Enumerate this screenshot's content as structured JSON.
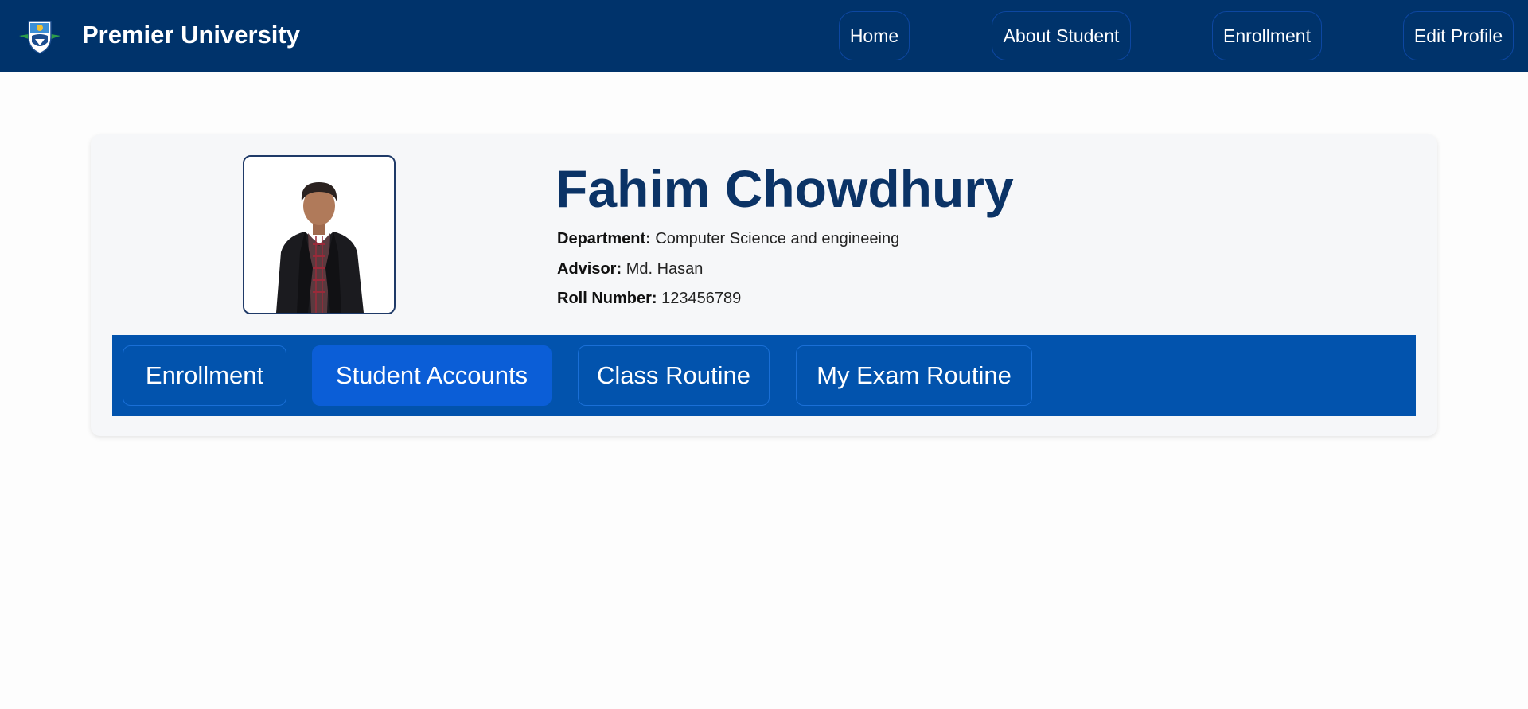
{
  "navbar": {
    "brand_name": "Premier University",
    "logo_icon": "university-crest-icon",
    "items": [
      {
        "label": "Home"
      },
      {
        "label": "About Student"
      },
      {
        "label": "Enrollment"
      },
      {
        "label": "Edit Profile"
      }
    ]
  },
  "profile": {
    "photo_icon": "student-photo",
    "name": "Fahim Chowdhury",
    "department_label": "Department:",
    "department_value": "Computer Science and engineeing",
    "advisor_label": "Advisor:",
    "advisor_value": "Md. Hasan",
    "roll_label": "Roll Number:",
    "roll_value": "123456789"
  },
  "tabs": [
    {
      "label": "Enrollment",
      "active": false
    },
    {
      "label": "Student Accounts",
      "active": true
    },
    {
      "label": "Class Routine",
      "active": false
    },
    {
      "label": "My Exam Routine",
      "active": false
    }
  ],
  "colors": {
    "navbar_bg": "#00336b",
    "tabbar_bg": "#0253ad",
    "active_tab": "#0b5ed7",
    "name_color": "#0b3366"
  }
}
